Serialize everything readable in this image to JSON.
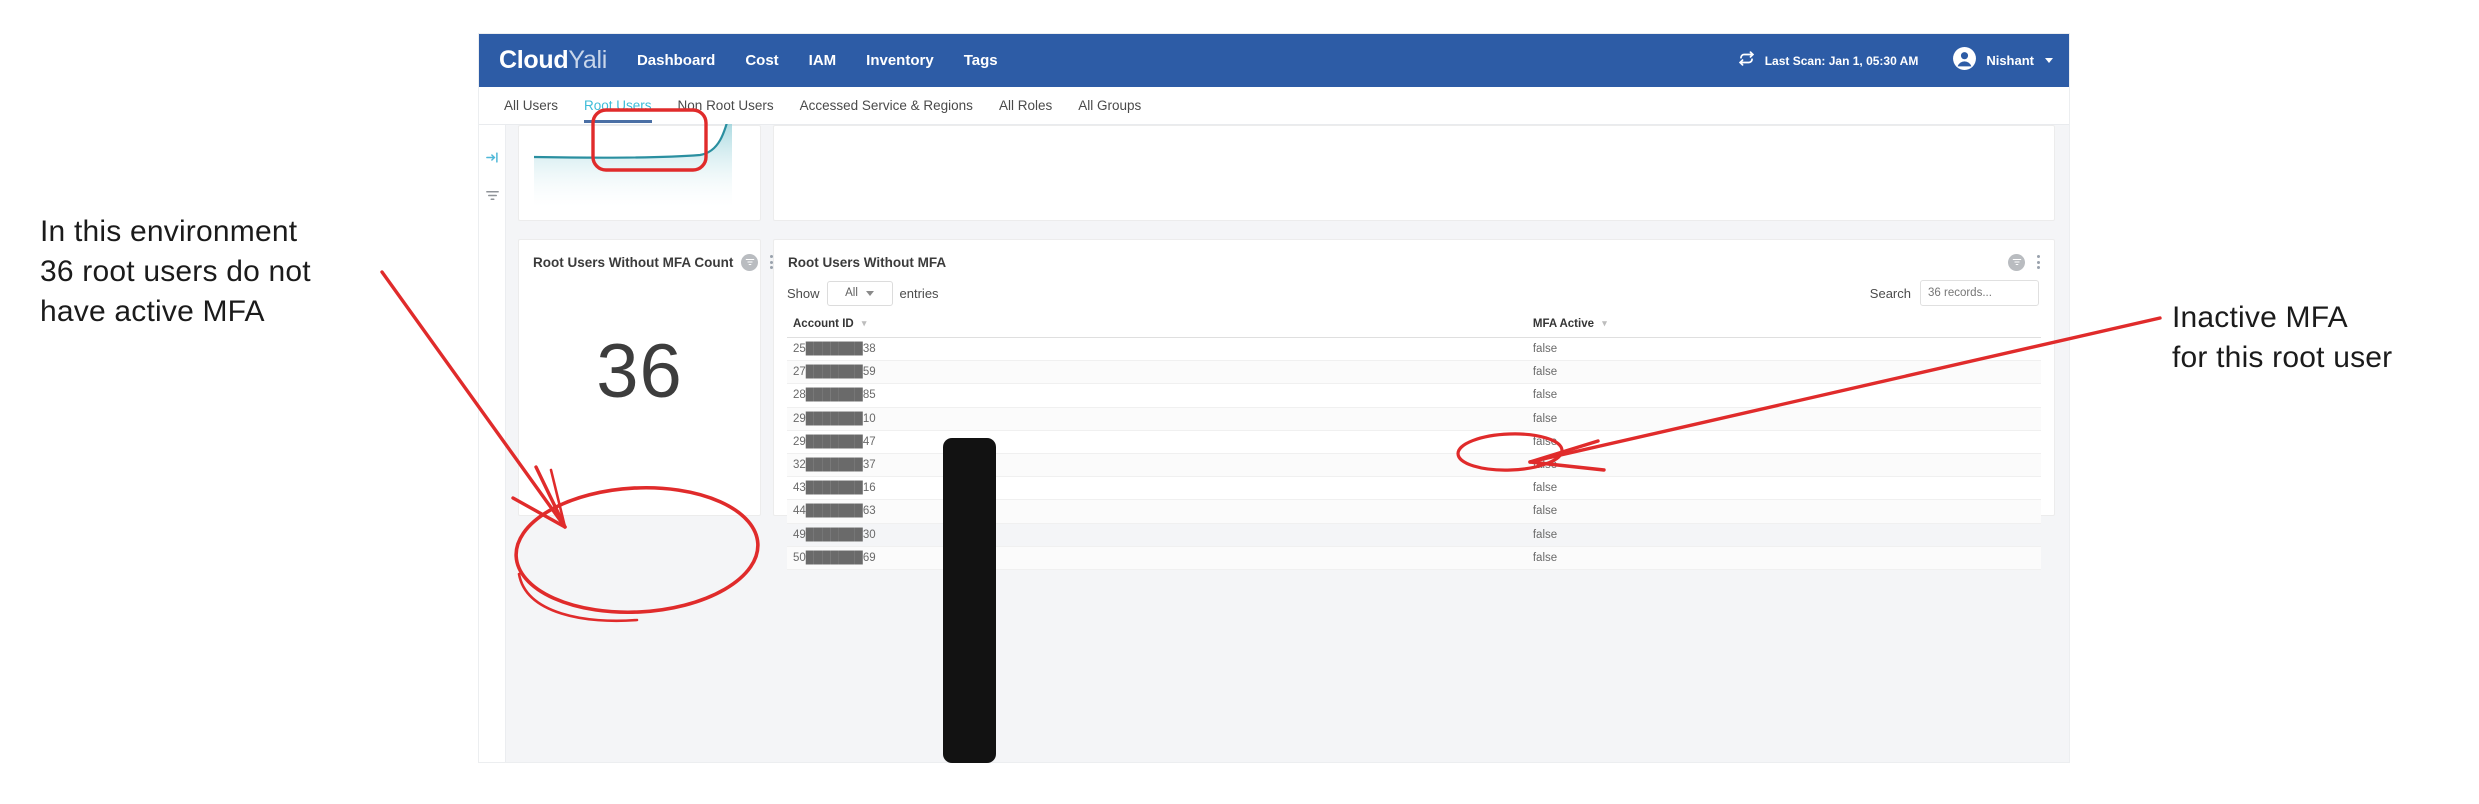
{
  "annotations": {
    "left_note": "In this environment\n36 root users do not\nhave active MFA",
    "right_note": "Inactive MFA\nfor this root user",
    "ink_color": "#e02b2b"
  },
  "navbar": {
    "brand_primary": "Cloud",
    "brand_secondary": "Yali",
    "links": [
      {
        "label": "Dashboard"
      },
      {
        "label": "Cost"
      },
      {
        "label": "IAM"
      },
      {
        "label": "Inventory"
      },
      {
        "label": "Tags"
      }
    ],
    "last_scan": "Last Scan: Jan 1, 05:30 AM",
    "refresh_icon": "refresh-icon",
    "user_icon": "user-avatar-icon",
    "user_name": "Nishant",
    "background_color": "#2d5ca6"
  },
  "subtabs": {
    "items": [
      {
        "label": "All Users",
        "active": false
      },
      {
        "label": "Root Users",
        "active": true
      },
      {
        "label": "Non Root Users",
        "active": false
      },
      {
        "label": "Accessed Service & Regions",
        "active": false
      },
      {
        "label": "All Roles",
        "active": false
      },
      {
        "label": "All Groups",
        "active": false
      }
    ],
    "active_color": "#3cbcd8",
    "underline_color": "#4a6fa5"
  },
  "left_rail": {
    "items": [
      {
        "icon": "collapse-panel-icon"
      },
      {
        "icon": "filter-icon"
      }
    ]
  },
  "cards": {
    "trend_card": {
      "chart_color": "#2a8fa0"
    },
    "count_card": {
      "title": "Root Users Without MFA Count",
      "filter_icon": "filter-icon",
      "menu_icon": "kebab-menu-icon",
      "value": "36"
    },
    "table_card": {
      "title": "Root Users Without MFA",
      "filter_icon": "filter-icon",
      "menu_icon": "kebab-menu-icon",
      "show_label": "Show",
      "entries_label": "entries",
      "entries_value": "All",
      "search_label": "Search",
      "search_placeholder": "36 records...",
      "search_value": "",
      "columns": [
        {
          "label": "Account ID"
        },
        {
          "label": "MFA Active"
        }
      ],
      "rows": [
        {
          "account_id": "25███████38",
          "mfa_active": "false"
        },
        {
          "account_id": "27███████59",
          "mfa_active": "false"
        },
        {
          "account_id": "28███████85",
          "mfa_active": "false"
        },
        {
          "account_id": "29███████10",
          "mfa_active": "false"
        },
        {
          "account_id": "29███████47",
          "mfa_active": "false"
        },
        {
          "account_id": "32███████37",
          "mfa_active": "false"
        },
        {
          "account_id": "43███████16",
          "mfa_active": "false"
        },
        {
          "account_id": "44███████63",
          "mfa_active": "false"
        },
        {
          "account_id": "49███████30",
          "mfa_active": "false"
        },
        {
          "account_id": "50███████69",
          "mfa_active": "false"
        }
      ]
    }
  }
}
